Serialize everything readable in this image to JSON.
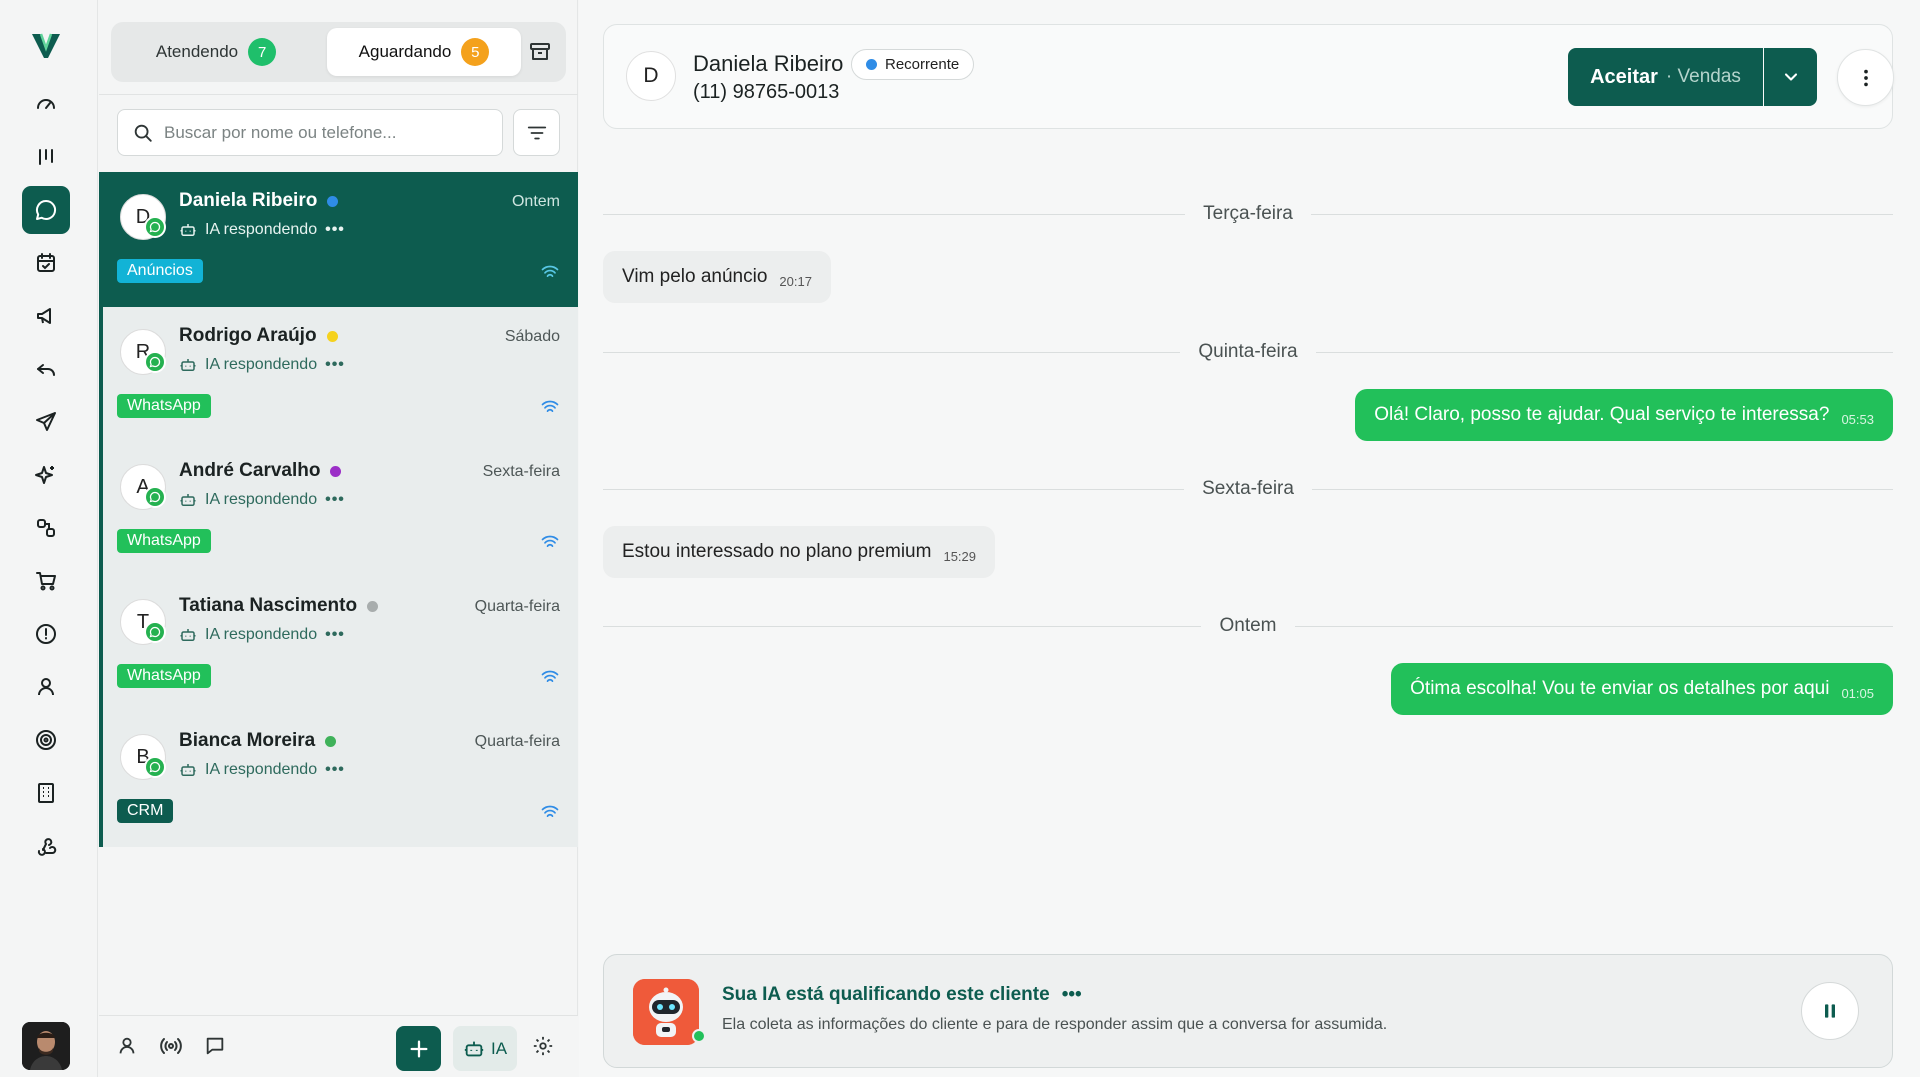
{
  "nav": {
    "items": [
      {
        "name": "dashboard-icon"
      },
      {
        "name": "kanban-icon"
      },
      {
        "name": "chat-icon",
        "active": true
      },
      {
        "name": "calendar-icon"
      },
      {
        "name": "megaphone-icon"
      },
      {
        "name": "reply-icon"
      },
      {
        "name": "send-icon"
      },
      {
        "name": "sparkles-icon"
      },
      {
        "name": "integrations-icon"
      },
      {
        "name": "cart-icon"
      },
      {
        "name": "alert-icon"
      },
      {
        "name": "user-icon"
      },
      {
        "name": "target-icon"
      },
      {
        "name": "building-icon"
      },
      {
        "name": "webhook-icon"
      }
    ]
  },
  "tabs": {
    "attending_label": "Atendendo",
    "attending_count": "7",
    "waiting_label": "Aguardando",
    "waiting_count": "5"
  },
  "search": {
    "placeholder": "Buscar por nome ou telefone..."
  },
  "conversations": [
    {
      "initial": "D",
      "name": "Daniela Ribeiro",
      "dot_color": "#2f8ce6",
      "date": "Ontem",
      "status": "IA respondendo",
      "dots": "•••",
      "tag": "Anúncios",
      "tag_color": "#12b3d6",
      "active": true
    },
    {
      "initial": "R",
      "name": "Rodrigo Araújo",
      "dot_color": "#f5d21e",
      "date": "Sábado",
      "status": "IA respondendo",
      "dots": "•••",
      "tag": "WhatsApp",
      "tag_color": "#22c05a"
    },
    {
      "initial": "A",
      "name": "André Carvalho",
      "dot_color": "#9b2fc7",
      "date": "Sexta-feira",
      "status": "IA respondendo",
      "dots": "•••",
      "tag": "WhatsApp",
      "tag_color": "#22c05a"
    },
    {
      "initial": "T",
      "name": "Tatiana Nascimento",
      "dot_color": "#a8adad",
      "date": "Quarta-feira",
      "status": "IA respondendo",
      "dots": "•••",
      "tag": "WhatsApp",
      "tag_color": "#22c05a"
    },
    {
      "initial": "B",
      "name": "Bianca Moreira",
      "dot_color": "#3fb25a",
      "date": "Quarta-feira",
      "status": "IA respondendo",
      "dots": "•••",
      "tag": "CRM",
      "tag_color": "#0d5c4f"
    }
  ],
  "list_footer": {
    "ia_label": "IA"
  },
  "chat": {
    "contact_initial": "D",
    "contact_name": "Daniela Ribeiro",
    "contact_phone": "(11) 98765-0013",
    "contact_badge": "Recorrente",
    "accept_label": "Aceitar",
    "accept_sub": "· Vendas",
    "separators": [
      "Terça-feira",
      "Quinta-feira",
      "Sexta-feira",
      "Ontem"
    ],
    "messages": [
      {
        "direction": "in",
        "text": "Vim pelo anúncio",
        "time": "20:17"
      },
      {
        "direction": "out",
        "text": "Olá! Claro, posso te ajudar. Qual serviço te interessa?",
        "time": "05:53"
      },
      {
        "direction": "in",
        "text": "Estou interessado no plano premium",
        "time": "15:29"
      },
      {
        "direction": "out",
        "text": "Ótima escolha! Vou te enviar os detalhes por aqui",
        "time": "01:05"
      }
    ]
  },
  "ia_banner": {
    "title": "Sua IA está qualificando este cliente",
    "dots": "•••",
    "description": "Ela coleta as informações do cliente e para de responder assim que a conversa for assumida."
  },
  "colors": {
    "brand": "#0d5c4f",
    "accent_green": "#22c05a"
  }
}
